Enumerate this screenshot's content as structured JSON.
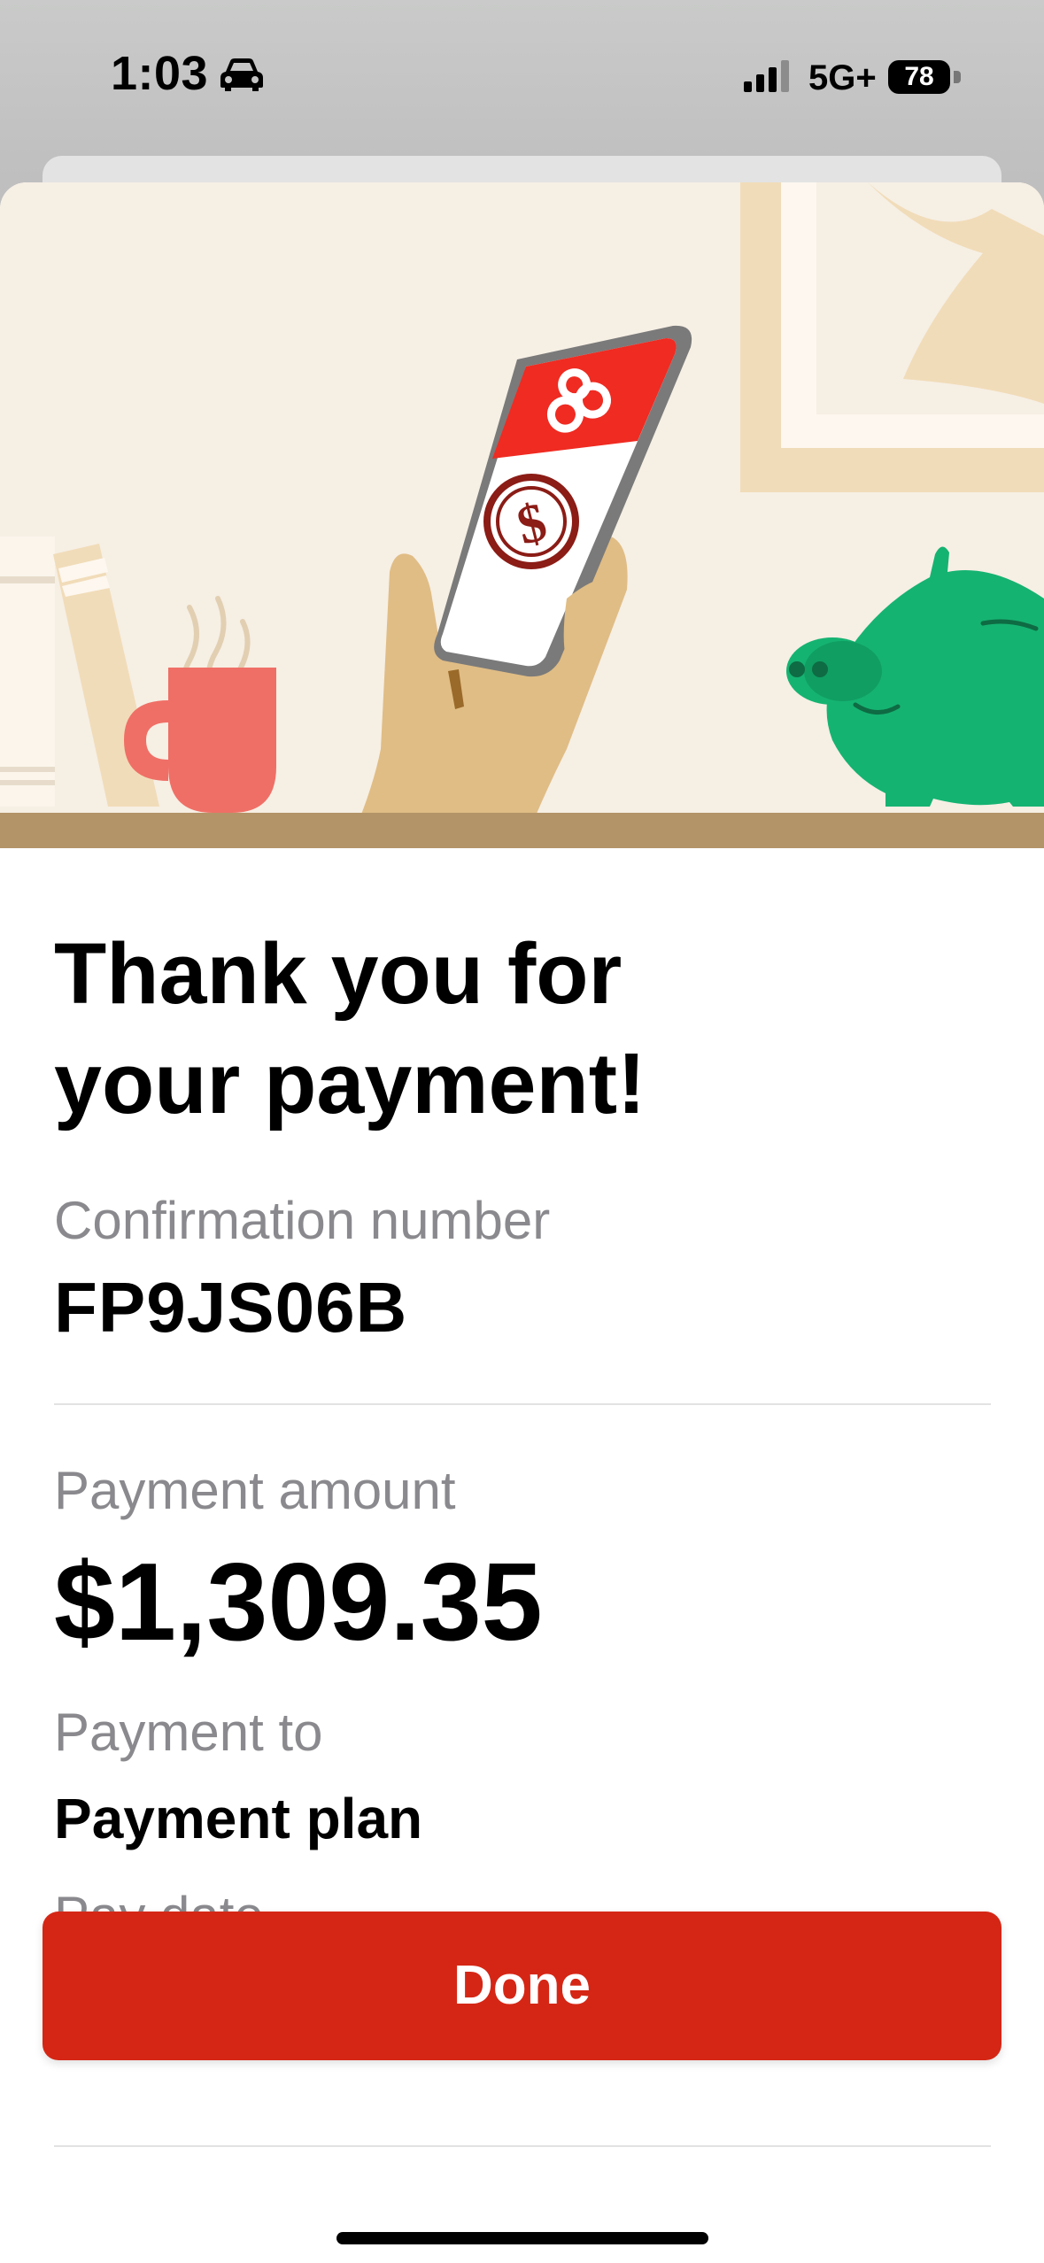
{
  "status_bar": {
    "time": "1:03",
    "network": "5G+",
    "battery": "78"
  },
  "confirmation": {
    "title": "Thank you for your payment!",
    "confirmation_label": "Confirmation number",
    "confirmation_number": "FP9JS06B",
    "amount_label": "Payment amount",
    "amount": "$1,309.35",
    "payment_to_label": "Payment to",
    "payment_to": "Payment plan",
    "pay_date_label": "Pay date"
  },
  "actions": {
    "done_label": "Done"
  },
  "icons": {
    "car": "car-icon",
    "signal": "cellular-signal-icon",
    "battery": "battery-icon",
    "hero": "payment-illustration"
  },
  "colors": {
    "accent": "#d52615",
    "label_gray": "#8a8a8e"
  }
}
